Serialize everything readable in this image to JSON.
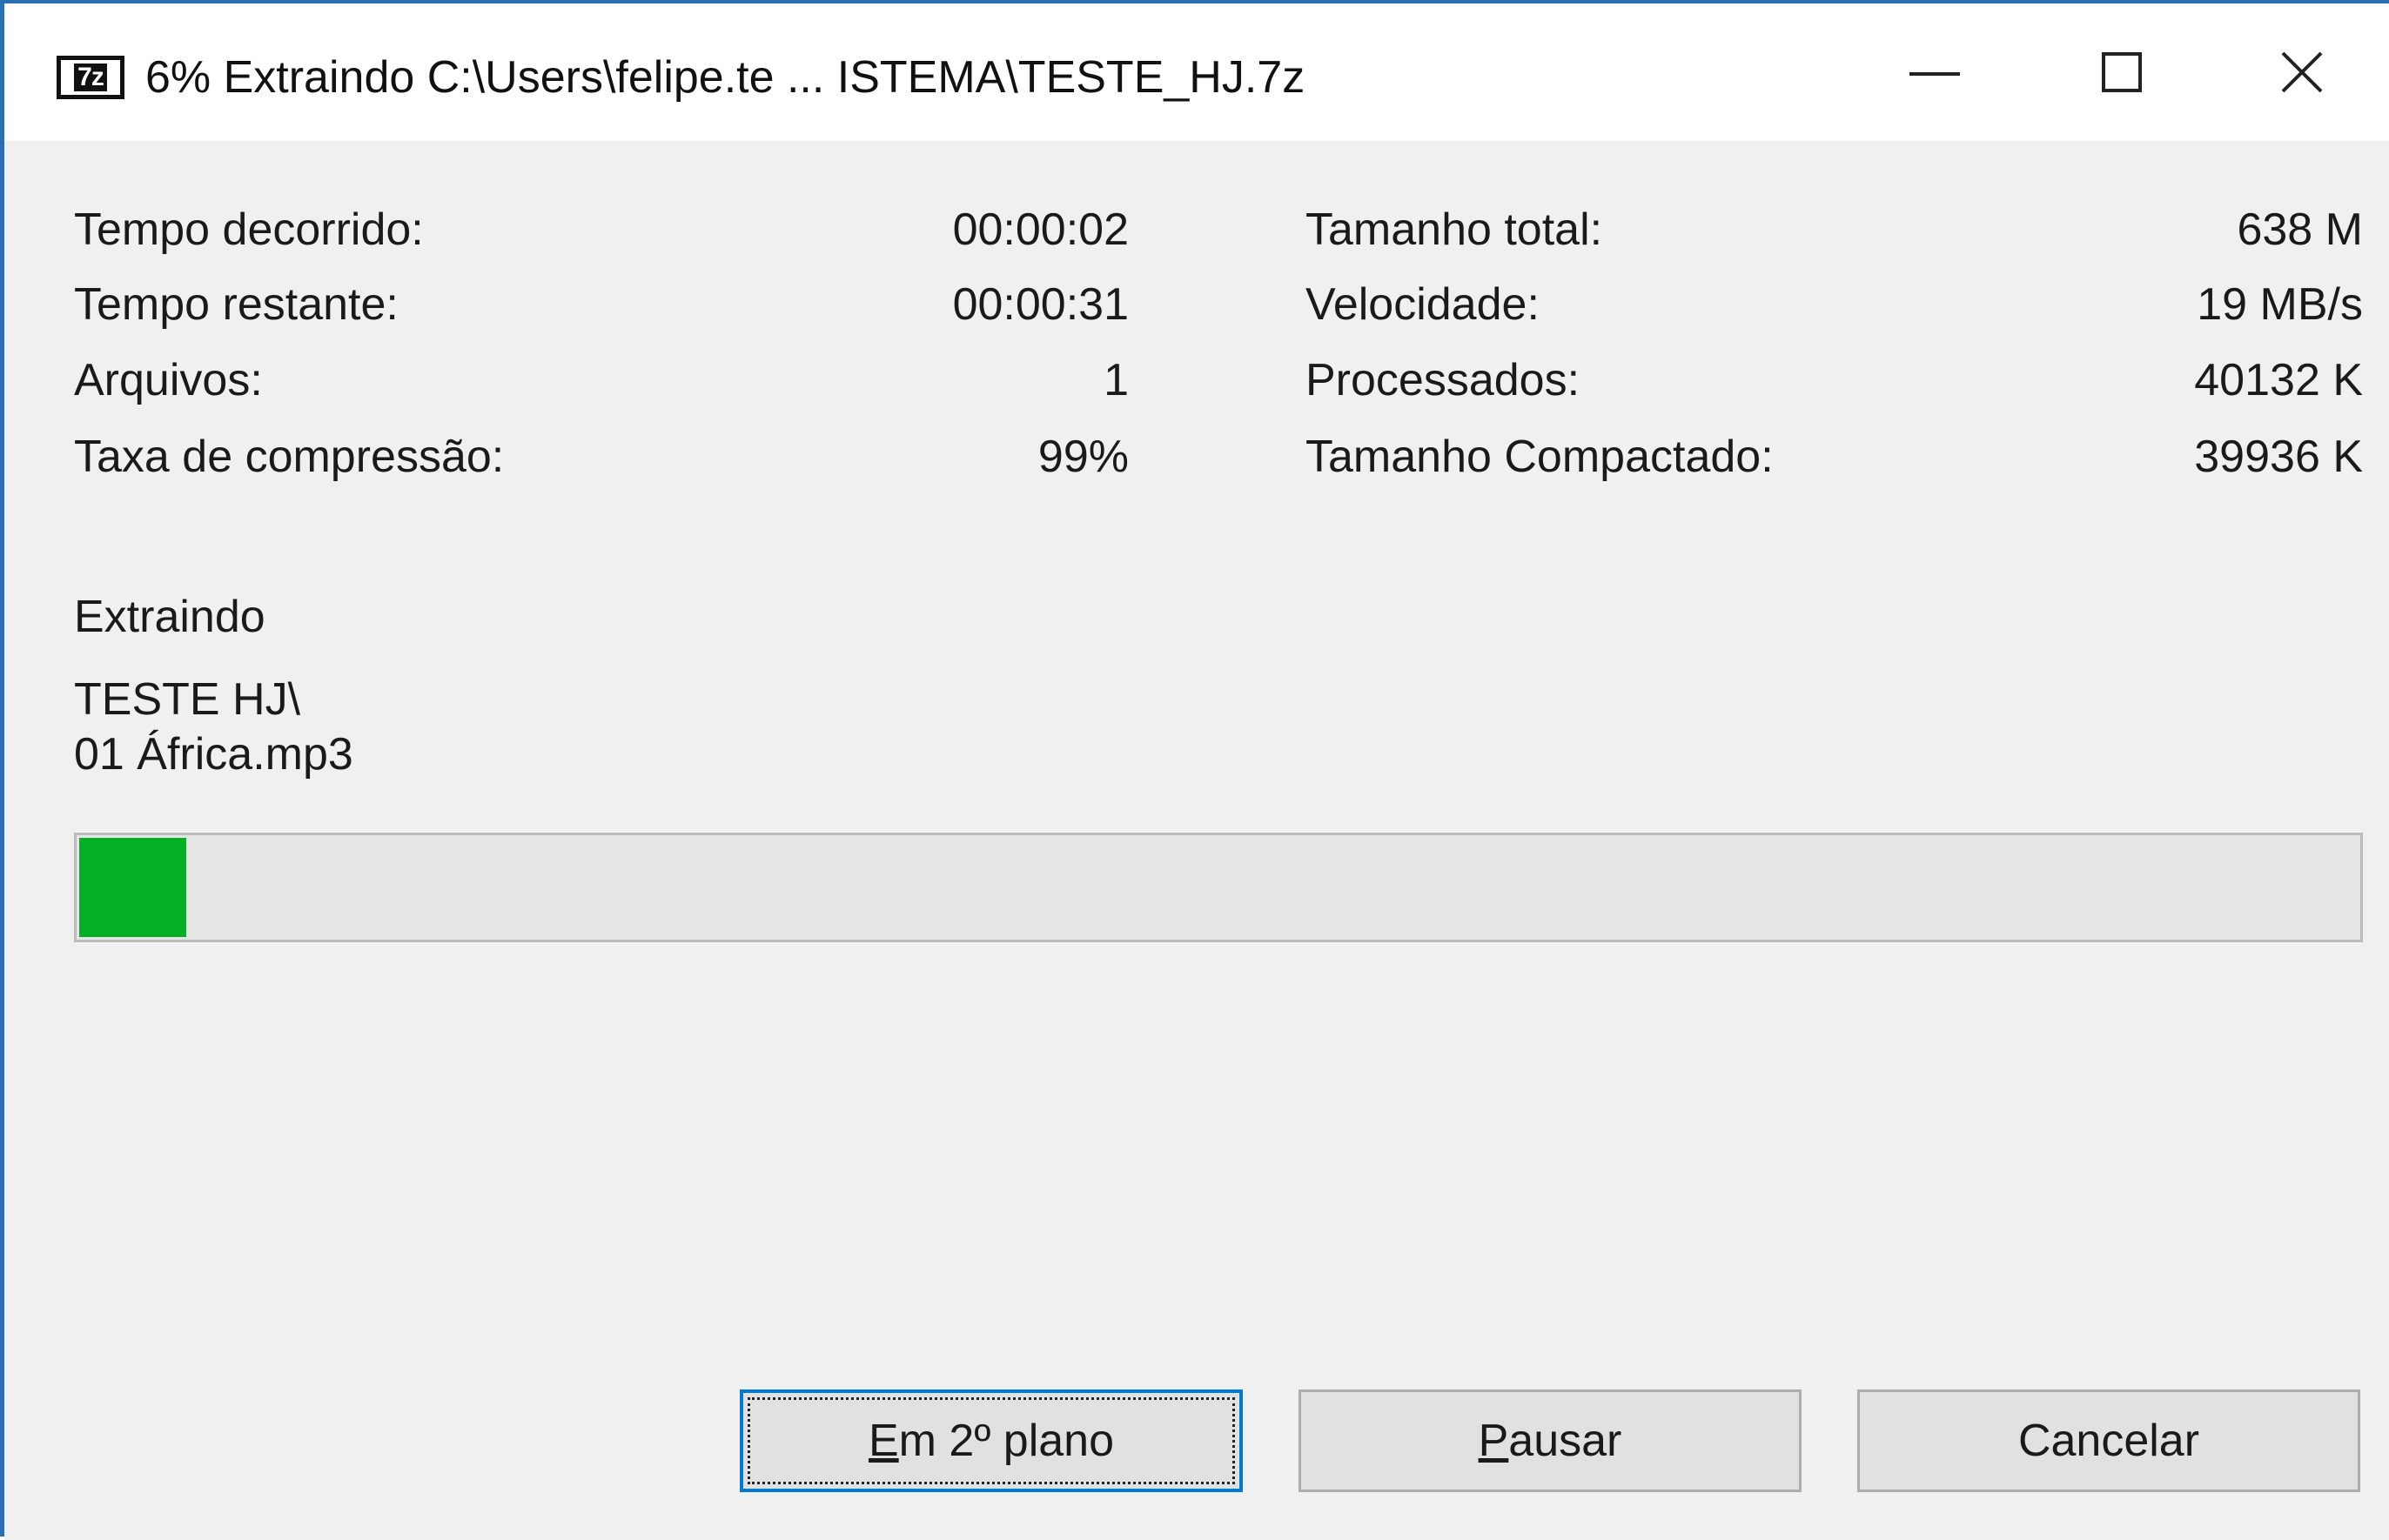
{
  "window": {
    "title": "6% Extraindo C:\\Users\\felipe.te ... ISTEMA\\TESTE_HJ.7z",
    "app_icon_text": "7z",
    "controls": [
      "minimize",
      "maximize",
      "close"
    ]
  },
  "stats": {
    "left": [
      {
        "label": "Tempo decorrido:",
        "value": "00:00:02"
      },
      {
        "label": "Tempo restante:",
        "value": "00:00:31"
      },
      {
        "label": "Arquivos:",
        "value": "1"
      },
      {
        "label": "Taxa de compressão:",
        "value": "99%"
      }
    ],
    "right": [
      {
        "label": "Tamanho total:",
        "value": "638 M"
      },
      {
        "label": "Velocidade:",
        "value": "19 MB/s"
      },
      {
        "label": "Processados:",
        "value": "40132 K"
      },
      {
        "label": "Tamanho Compactado:",
        "value": "39936 K"
      }
    ]
  },
  "status": {
    "operation": "Extraindo",
    "folder": "TESTE HJ\\",
    "file": "01 África.mp3"
  },
  "progress": {
    "fraction": 0.047,
    "color": "#06b025"
  },
  "buttons": {
    "background": {
      "mnemonic": "E",
      "rest": "m 2º plano"
    },
    "pause": {
      "mnemonic": "P",
      "rest": "ausar"
    },
    "cancel": {
      "label": "Cancelar"
    }
  },
  "colors": {
    "accent": "#0078d7",
    "window_border": "#2b6fb3"
  }
}
